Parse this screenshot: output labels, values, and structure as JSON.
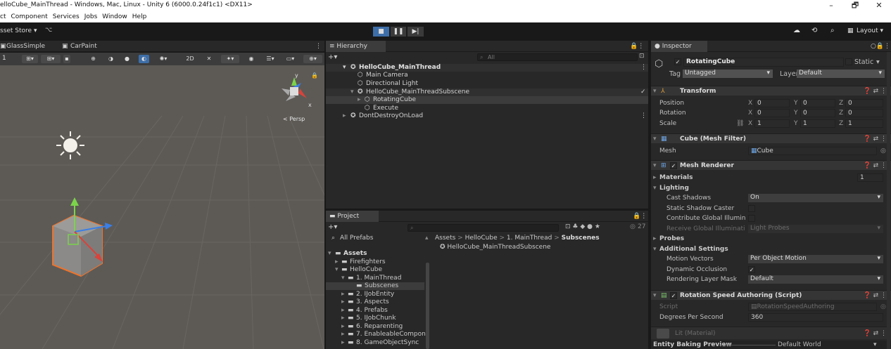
{
  "window": {
    "title": "elloCube_MainThread - Windows, Mac, Linux - Unity 6 (6000.0.24f1c1) <DX11>",
    "controls": [
      "–",
      "🗗",
      "✕"
    ]
  },
  "menu": [
    "ct",
    "Component",
    "Services",
    "Jobs",
    "Window",
    "Help"
  ],
  "toolbar": {
    "asset_store": "sset Store ▾",
    "play_icon": "■",
    "pause_icon": "❚❚",
    "step_icon": "▶|",
    "layout": "Layout ▾"
  },
  "scene": {
    "tabs": [
      "GlassSimple",
      "CarPaint"
    ],
    "toolbar_value": "1",
    "persp_label": "< Persp",
    "gizmo_y": "y",
    "gizmo_x": "x"
  },
  "hierarchy": {
    "tab": "Hierarchy",
    "search_placeholder": "All",
    "items": [
      {
        "label": "HelloCube_MainThread",
        "indent": 0,
        "bold": true,
        "icon": "unity-scene-icon"
      },
      {
        "label": "Main Camera",
        "indent": 1,
        "icon": "gameobject-icon"
      },
      {
        "label": "Directional Light",
        "indent": 1,
        "icon": "gameobject-icon"
      },
      {
        "label": "HelloCube_MainThreadSubscene",
        "indent": 1,
        "icon": "subscene-icon"
      },
      {
        "label": "RotatingCube",
        "indent": 2,
        "icon": "gameobject-icon"
      },
      {
        "label": "Execute",
        "indent": 2,
        "icon": "gameobject-icon"
      },
      {
        "label": "DontDestroyOnLoad",
        "indent": 0,
        "icon": "unity-scene-icon"
      }
    ]
  },
  "project": {
    "tab": "Project",
    "count": "27",
    "all_prefabs": "All Prefabs",
    "breadcrumb": [
      "Assets",
      "HelloCube",
      "1. MainThread",
      "Subscenes"
    ],
    "file": "HelloCube_MainThreadSubscene",
    "tree": [
      {
        "label": "Assets",
        "indent": 0,
        "bold": true
      },
      {
        "label": "Firefighters",
        "indent": 1
      },
      {
        "label": "HelloCube",
        "indent": 1
      },
      {
        "label": "1. MainThread",
        "indent": 2
      },
      {
        "label": "Subscenes",
        "indent": 3
      },
      {
        "label": "2. IJobEntity",
        "indent": 2
      },
      {
        "label": "3. Aspects",
        "indent": 2
      },
      {
        "label": "4. Prefabs",
        "indent": 2
      },
      {
        "label": "5. IJobChunk",
        "indent": 2
      },
      {
        "label": "6. Reparenting",
        "indent": 2
      },
      {
        "label": "7. EnableableCompone",
        "indent": 2
      },
      {
        "label": "8. GameObjectSync",
        "indent": 2
      }
    ]
  },
  "inspector": {
    "tab": "Inspector",
    "object_name": "RotatingCube",
    "static_label": "Static",
    "tag_label": "Tag",
    "tag_value": "Untagged",
    "layer_label": "Layer",
    "layer_value": "Default",
    "transform": {
      "title": "Transform",
      "position_label": "Position",
      "rotation_label": "Rotation",
      "scale_label": "Scale",
      "position": [
        "0",
        "0",
        "0"
      ],
      "rotation": [
        "0",
        "0",
        "0"
      ],
      "scale": [
        "1",
        "1",
        "1"
      ],
      "axis": [
        "X",
        "Y",
        "Z"
      ]
    },
    "mesh_filter": {
      "title": "Cube (Mesh Filter)",
      "mesh_label": "Mesh",
      "mesh_value": "Cube"
    },
    "mesh_renderer": {
      "title": "Mesh Renderer",
      "materials_label": "Materials",
      "materials_count": "1",
      "lighting_label": "Lighting",
      "cast_shadows_label": "Cast Shadows",
      "cast_shadows_value": "On",
      "static_shadow_label": "Static Shadow Caster",
      "contribute_gi_label": "Contribute Global Illuminati",
      "receive_gi_label": "Receive Global Illumination",
      "receive_gi_value": "Light Probes",
      "probes_label": "Probes",
      "additional_label": "Additional Settings",
      "motion_vectors_label": "Motion Vectors",
      "motion_vectors_value": "Per Object Motion",
      "dynamic_occlusion_label": "Dynamic Occlusion",
      "rendering_layer_label": "Rendering Layer Mask",
      "rendering_layer_value": "Default"
    },
    "rotation_speed": {
      "title": "Rotation Speed Authoring (Script)",
      "script_label": "Script",
      "script_value": "RotationSpeedAuthoring",
      "dps_label": "Degrees Per Second",
      "dps_value": "360"
    },
    "material_label": "Lit (Material)",
    "baking_label": "Entity Baking Preview",
    "baking_value": "Default World"
  },
  "colors": {
    "selection": "#2c4a6b",
    "x_axis": "#d8433b",
    "y_axis": "#7bd34a",
    "z_axis": "#3a7ee6",
    "selected_outline": "#f0732a"
  }
}
